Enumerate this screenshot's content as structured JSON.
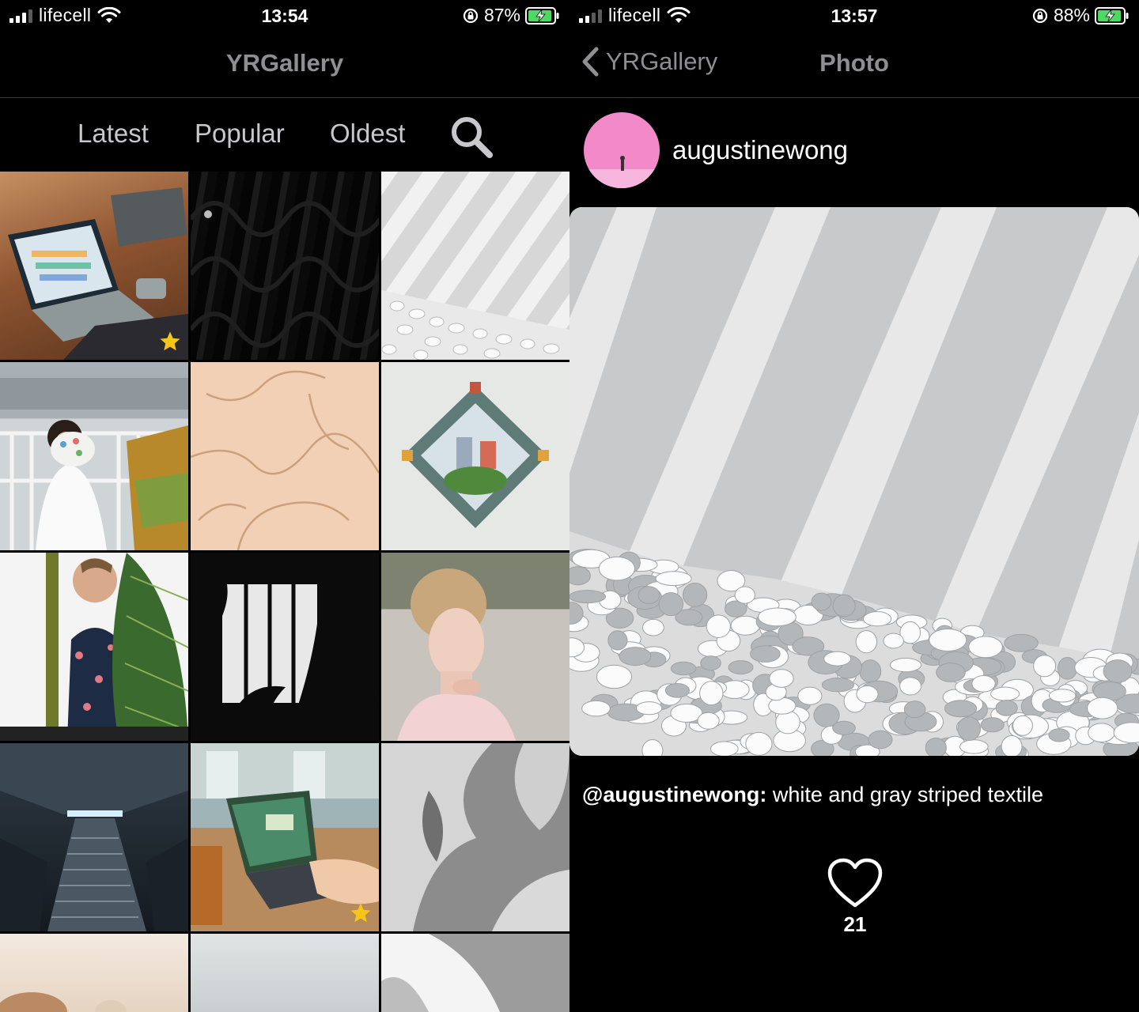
{
  "left_screen": {
    "status_bar": {
      "carrier": "lifecell",
      "time": "13:54",
      "battery": "87%"
    },
    "nav": {
      "title": "YRGallery"
    },
    "filters": {
      "latest": "Latest",
      "popular": "Popular",
      "oldest": "Oldest"
    },
    "grid": {
      "tiles": [
        {
          "subject": "laptop on leather couch",
          "starred": true
        },
        {
          "subject": "black pleated fabric",
          "starred": false
        },
        {
          "subject": "striped shadows on white pebbles",
          "starred": false
        },
        {
          "subject": "woman holding paint palette",
          "starred": false
        },
        {
          "subject": "beige textured wall",
          "starred": false
        },
        {
          "subject": "diamond tile frame with city view",
          "starred": false
        },
        {
          "subject": "man behind palm leaf",
          "starred": false
        },
        {
          "subject": "plant silhouette in window",
          "starred": false
        },
        {
          "subject": "woman with braided hair",
          "starred": false
        },
        {
          "subject": "subway stairs",
          "starred": false
        },
        {
          "subject": "laptop on wooden table",
          "starred": true
        },
        {
          "subject": "leaf shadows on gray wall",
          "starred": false
        },
        {
          "subject": "warm cream photo",
          "starred": false
        },
        {
          "subject": "pale gray photo",
          "starred": false
        },
        {
          "subject": "leaf shadows on white wall",
          "starred": false
        }
      ]
    }
  },
  "right_screen": {
    "status_bar": {
      "carrier": "lifecell",
      "time": "13:57",
      "battery": "88%"
    },
    "nav": {
      "back_label": "YRGallery",
      "title": "Photo"
    },
    "author": {
      "username": "augustinewong"
    },
    "photo": {
      "subject": "white and gray striped shadows over white pebbles"
    },
    "caption": {
      "author": "@augustinewong:",
      "text": " white and gray striped textile"
    },
    "likes": {
      "count": "21"
    }
  },
  "colors": {
    "background": "#000000",
    "nav_text": "#8e8e93",
    "star": "#f5c518",
    "battery_green": "#4cd964",
    "avatar_pink": "#f28ac9"
  }
}
